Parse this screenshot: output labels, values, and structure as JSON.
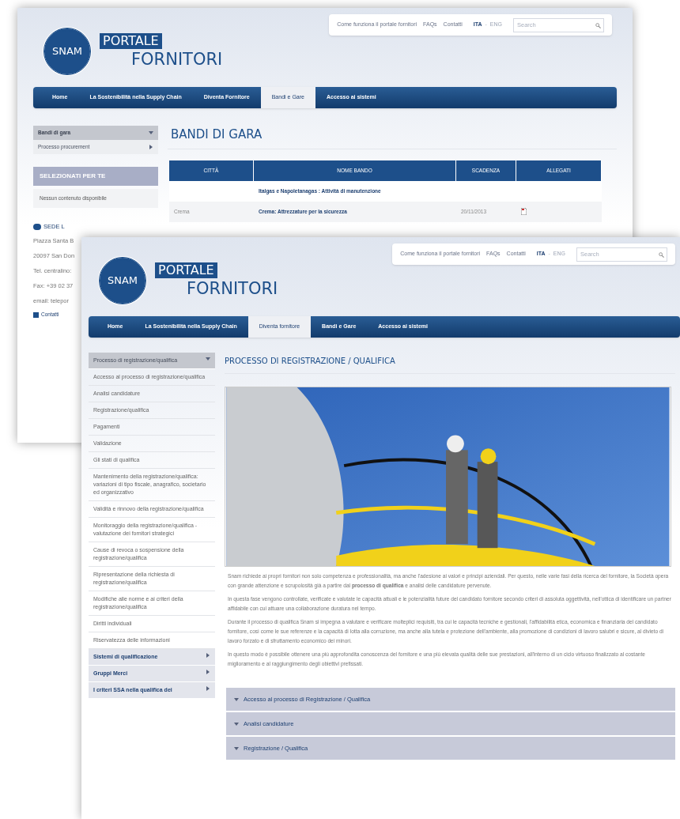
{
  "back_page": {
    "logo": {
      "emblem": "SNAM",
      "line1": "PORTALE",
      "line2": "FORNITORI"
    },
    "top_links": [
      "Come funziona il portale fornitori",
      "FAQs",
      "Contatti"
    ],
    "languages": [
      {
        "label": "ITA",
        "selected": true
      },
      {
        "label": "ENG",
        "selected": false
      }
    ],
    "language_separator": "-",
    "search": {
      "placeholder": "Search"
    },
    "nav": [
      {
        "label": "Home",
        "selected": false
      },
      {
        "label": "La Sostenibilità nella Supply Chain",
        "selected": false
      },
      {
        "label": "Diventa Fornitore",
        "selected": false
      },
      {
        "label": "Bandi e Gare",
        "selected": true
      },
      {
        "label": "Accesso ai sistemi",
        "selected": false
      }
    ],
    "sidebar": {
      "menu": [
        {
          "label": "Bandi di gara",
          "selected": true,
          "expanded": true
        },
        {
          "label": "Processo procurement",
          "selected": false,
          "expanded": false
        }
      ],
      "box_title": "SELEZIONATI PER TE",
      "box_text": "Nessun contenuto disponibile",
      "contacts_title": "SEDE L",
      "contacts_lines": [
        "Piazza Santa B",
        "20097 San Don",
        "Tel. centralino:",
        "Fax: +39 02 37",
        "email: telepor"
      ],
      "contacts_link": "Contatti"
    },
    "title": "BANDI DI GARA",
    "table": {
      "columns": [
        "CITTÀ",
        "NOME BANDO",
        "SCADENZA",
        "ALLEGATI"
      ],
      "rows": [
        {
          "name": "Italgas e Napoletanagas : Attività di manutenzione",
          "attachment": false
        },
        {
          "city": "Crema",
          "name": "Crema: Attrezzature per la sicurezza",
          "deadline": "20/11/2013",
          "attachment": true
        }
      ]
    }
  },
  "front_page": {
    "logo": {
      "emblem": "SNAM",
      "line1": "PORTALE",
      "line2": "FORNITORI"
    },
    "top_links": [
      "Come funziona il portale fornitori",
      "FAQs",
      "Contatti"
    ],
    "languages": [
      {
        "label": "ITA",
        "selected": true
      },
      {
        "label": "ENG",
        "selected": false
      }
    ],
    "language_separator": "-",
    "search": {
      "placeholder": "Search"
    },
    "nav": [
      {
        "label": "Home",
        "selected": false
      },
      {
        "label": "La Sostenibilità nella Supply Chain",
        "selected": false
      },
      {
        "label": "Diventa fornitore",
        "selected": true
      },
      {
        "label": "Bandi e Gare",
        "selected": false
      },
      {
        "label": "Accesso ai sistemi",
        "selected": false
      }
    ],
    "sidebar": [
      {
        "kind": "section",
        "label": "Processo di registrazione/qualifica",
        "selected": true,
        "expanded": true
      },
      {
        "kind": "sub",
        "label": "Accesso al processo di registrazione/qualifica"
      },
      {
        "kind": "sub",
        "label": "Analisi candidature"
      },
      {
        "kind": "sub",
        "label": "Registrazione/qualifica"
      },
      {
        "kind": "sub",
        "label": "Pagamenti"
      },
      {
        "kind": "sub",
        "label": "Validazione"
      },
      {
        "kind": "sub",
        "label": "Gli stati di qualifica"
      },
      {
        "kind": "sub",
        "label": "Mantenimento della registrazione/qualifica: variazioni di tipo fiscale, anagrafico, societario ed organizzativo"
      },
      {
        "kind": "sub",
        "label": "Validità e rinnovo della registrazione/qualifica"
      },
      {
        "kind": "sub",
        "label": "Monitoraggio della registrazione/qualifica - valutazione dei fornitori strategici"
      },
      {
        "kind": "sub",
        "label": "Cause di revoca o sospensione della registrazione/qualifica"
      },
      {
        "kind": "sub",
        "label": "Ripresentazione della richiesta di registrazione/qualifica"
      },
      {
        "kind": "sub",
        "label": "Modifiche alle norme e ai criteri della registrazione/qualifica"
      },
      {
        "kind": "sub",
        "label": "Diritti individuali"
      },
      {
        "kind": "sub",
        "label": "Riservatezza delle informazioni"
      },
      {
        "kind": "section",
        "label": "Sistemi di qualificazione",
        "selected": false,
        "expanded": false
      },
      {
        "kind": "section",
        "label": "Gruppi Merci",
        "selected": false,
        "expanded": false
      },
      {
        "kind": "section",
        "label": "I criteri SSA nella qualifica dei",
        "selected": false,
        "expanded": false
      }
    ],
    "title": "PROCESSO DI REGISTRAZIONE / QUALIFICA",
    "paragraphs": [
      "Snam richiede ai propri fornitori non solo competenza e professionalità, ma anche l'adesione ai valori e principi aziendali. Per questo, nelle varie fasi della ricerca del fornitore, la Società opera con grande attenzione e scrupolosità già a partire dal **processo di qualifica** e analisi delle candidature pervenute.",
      "In questa fase vengono controllate, verificate e valutate le capacità attuali e le potenzialità future del candidato fornitore secondo criteri di assoluta oggettività, nell'ottica di identificare un partner affidabile con cui attuare una collaborazione duratura nel tempo.",
      "Durante il processo di qualifica Snam si impegna a valutare e verificare molteplici requisiti, tra cui le capacità tecniche e gestionali, l'affidabilità etica, economica e finanziaria del candidato fornitore, così come le sue referenze e la capacità di lotta alla corruzione, ma anche alla tutela e protezione dell'ambiente, alla promozione di condizioni di lavoro salubri e sicure, al divieto di lavoro forzato e di sfruttamento economico dei minori.",
      "In questo modo è possibile ottenere una più approfondita conoscenza del fornitore e una più elevata qualità delle sue prestazioni, all'interno di un ciclo virtuoso finalizzato al costante miglioramento e al raggiungimento degli obiettivi prefissati."
    ],
    "accordion": [
      {
        "label": "Accesso al processo di Registrazione / Qualifica",
        "expanded": false
      },
      {
        "label": "Analisi candidature",
        "expanded": false
      },
      {
        "label": "Registrazione / Qualifica",
        "expanded": false
      }
    ]
  }
}
